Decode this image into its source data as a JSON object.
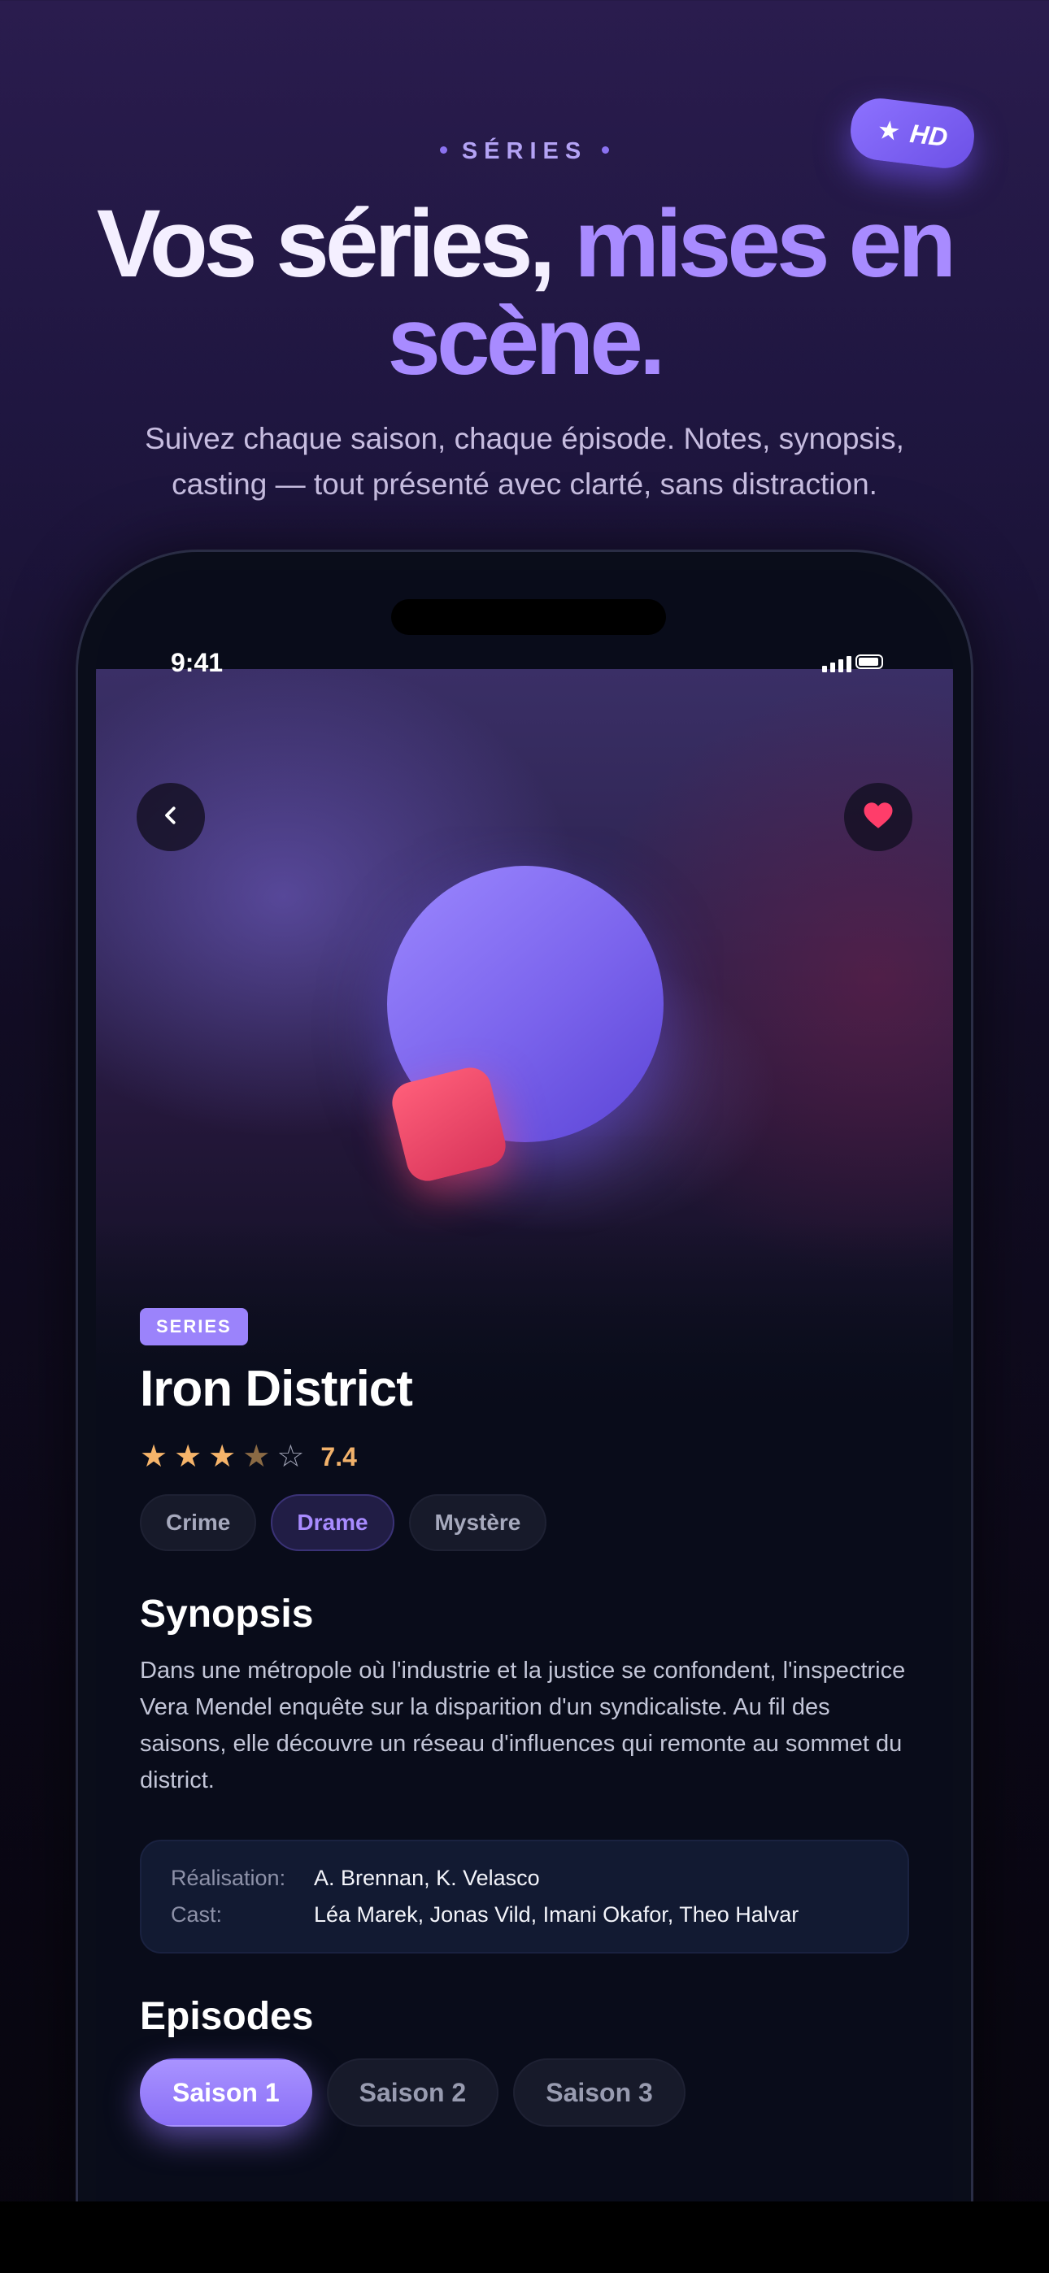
{
  "hero": {
    "eyebrow": "SÉRIES",
    "headline_white": "Vos séries,",
    "headline_purple_1": "mises en",
    "headline_purple_2": "scène.",
    "subhead": "Suivez chaque saison, chaque épisode. Notes, synopsis, casting — tout présenté avec clarté, sans distraction.",
    "badge_label": "HD"
  },
  "status_bar": {
    "time": "9:41"
  },
  "show": {
    "type_label": "SERIES",
    "title": "Iron District",
    "rating_value": "7.4",
    "rating_stars": 3.5,
    "rating_max": 5,
    "genres": [
      "Crime",
      "Drame",
      "Mystère"
    ],
    "active_genre_index": 1,
    "synopsis_heading": "Synopsis",
    "synopsis": "Dans une métropole où l'industrie et la justice se confondent, l'inspectrice Vera Mendel enquête sur la disparition d'un syndicaliste. Au fil des saisons, elle découvre un réseau d'influences qui remonte au sommet du district.",
    "credits": [
      {
        "label": "Réalisation:",
        "value": "A. Brennan, K. Velasco"
      },
      {
        "label": "Cast:",
        "value": "Léa Marek, Jonas Vild, Imani Okafor, Theo Halvar"
      }
    ],
    "episodes_heading": "Episodes",
    "seasons": [
      "Saison 1",
      "Saison 2",
      "Saison 3"
    ],
    "active_season_index": 0,
    "favorited": true
  },
  "colors": {
    "accent": "#9b83fb",
    "star": "#f6b46a",
    "heart": "#ff3d6a",
    "background": "#090c1a"
  },
  "icons": {
    "back": "chevron-left-icon",
    "favorite": "heart-icon",
    "badge": "star-icon",
    "signal": "signal-bars-icon",
    "battery": "battery-icon"
  }
}
